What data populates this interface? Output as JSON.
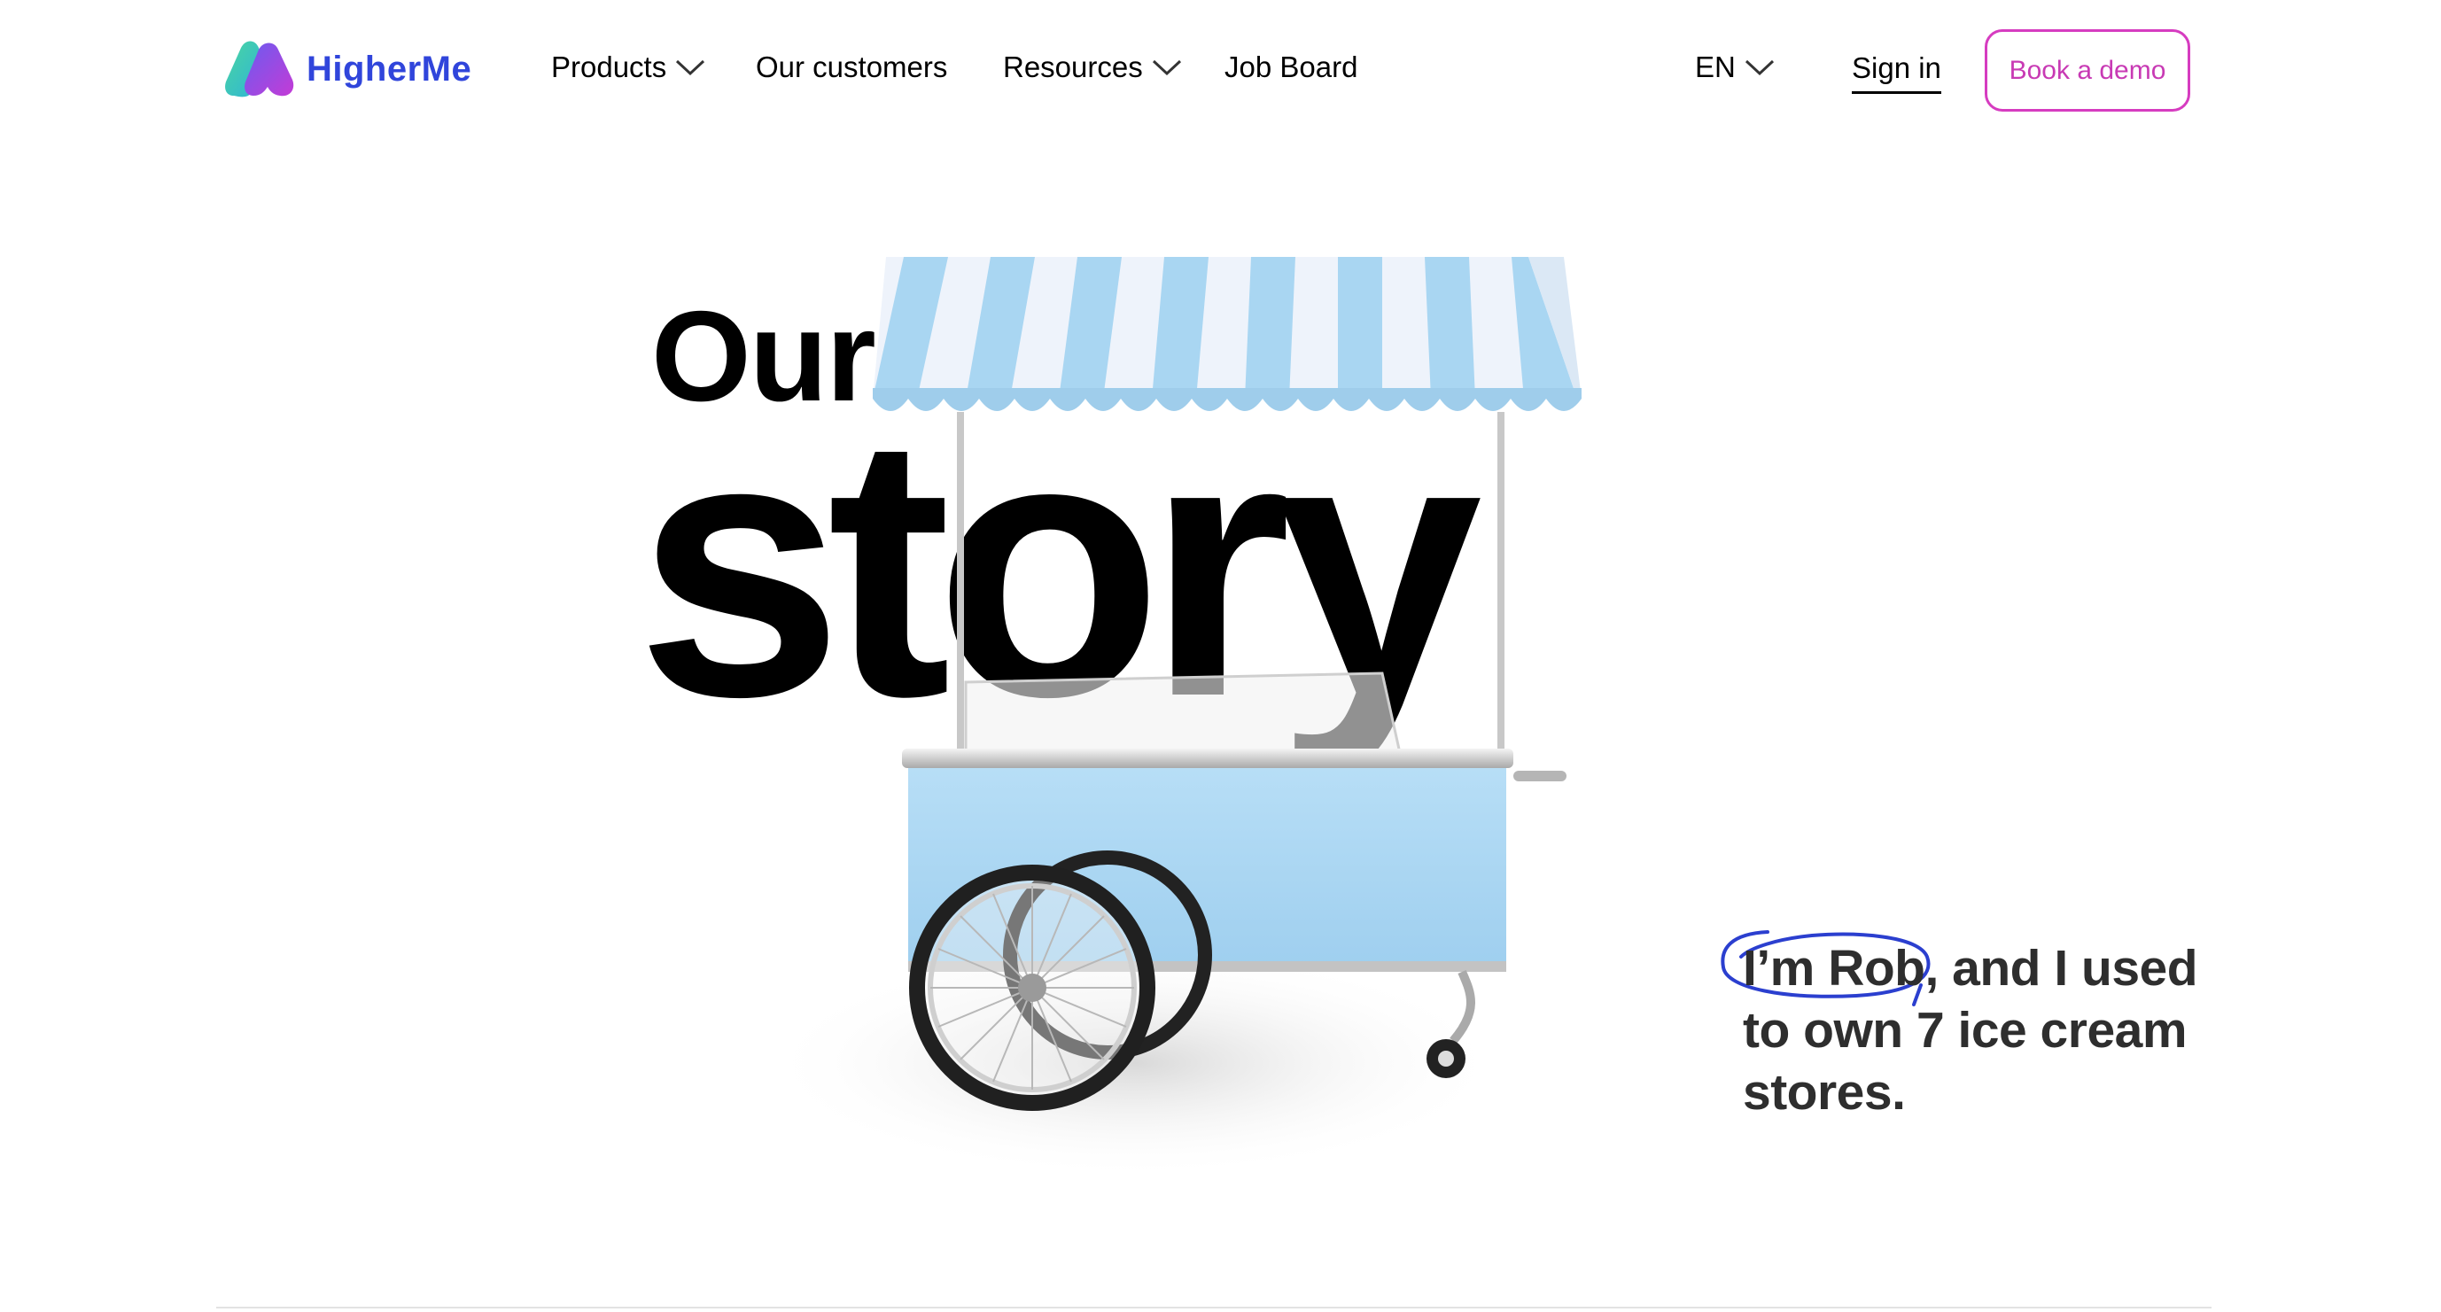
{
  "header": {
    "logo_text": "HigherMe",
    "nav": [
      {
        "label": "Products"
      },
      {
        "label": "Our customers"
      },
      {
        "label": "Resources"
      },
      {
        "label": "Job Board"
      }
    ],
    "language": "EN",
    "sign_in": "Sign in",
    "book_demo": "Book a demo"
  },
  "hero": {
    "title_top": "Our",
    "title_main": "story",
    "intro_highlight": "I’m Rob,",
    "intro_rest": " and I used to own 7 ice cream stores."
  },
  "colors": {
    "brand": "#3045db",
    "accent": "#d63cc0",
    "cart_blue": "#a9d6f2",
    "awning_light": "#eef3fb",
    "highlight_circle": "#2b3fcf"
  },
  "icons": {
    "logo": "higherme-logo-icon",
    "dropdown": "chevron-down-icon",
    "hero_image": "ice-cream-cart-illustration"
  }
}
